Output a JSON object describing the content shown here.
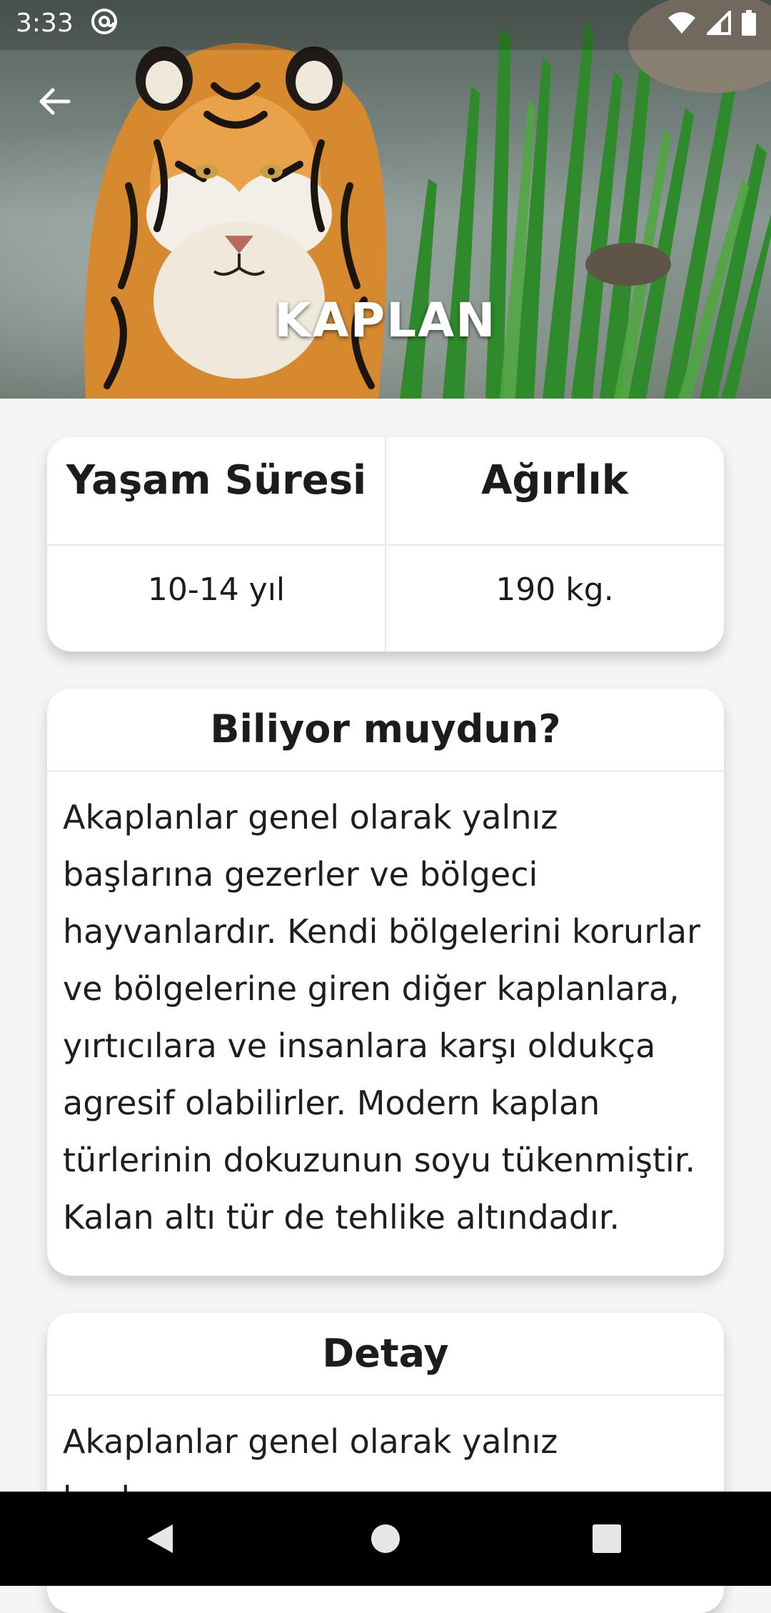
{
  "status_bar": {
    "time": "3:33"
  },
  "header": {
    "title": "KAPLAN",
    "back_icon": "arrow-left-icon",
    "hero_image": "tiger-in-water"
  },
  "stats": {
    "lifespan_label": "Yaşam Süresi",
    "weight_label": "Ağırlık",
    "lifespan_value": "10-14 yıl",
    "weight_value": "190 kg."
  },
  "fact": {
    "title": "Biliyor muydun?",
    "text": "Akaplanlar genel olarak yalnız başlarına gezerler ve bölgeci hayvanlardır. Kendi bölgelerini korurlar ve bölgelerine giren diğer kaplanlara, yırtıcılara ve insanlara karşı oldukça agresif olabilirler. Modern kaplan türlerinin dokuzunun soyu tükenmiştir. Kalan altı tür de tehlike altındadır."
  },
  "detail": {
    "title": "Detay",
    "text": "Akaplanlar genel olarak yalnız başlarına"
  },
  "colors": {
    "background": "#f5f5f5",
    "card": "#ffffff",
    "text": "#1c1c1c"
  }
}
